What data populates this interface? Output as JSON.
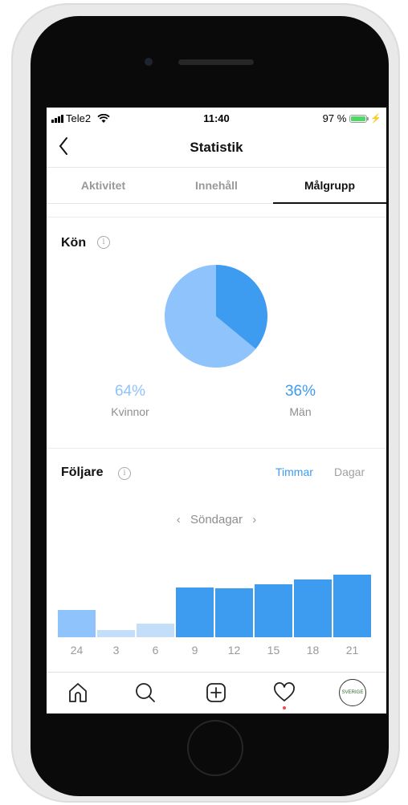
{
  "status_bar": {
    "carrier": "Tele2",
    "time": "11:40",
    "battery": "97 %",
    "battery_level": 0.97
  },
  "nav": {
    "title": "Statistik"
  },
  "tabs": [
    {
      "label": "Aktivitet",
      "active": false
    },
    {
      "label": "Innehåll",
      "active": false
    },
    {
      "label": "Målgrupp",
      "active": true
    }
  ],
  "gender": {
    "title": "Kön",
    "info_icon": "info-icon",
    "women": {
      "pct": "64%",
      "label": "Kvinnor",
      "value": 64,
      "color": "#8ec3fb"
    },
    "men": {
      "pct": "36%",
      "label": "Män",
      "value": 36,
      "color": "#3d9bf0"
    }
  },
  "followers": {
    "title": "Följare",
    "toggle_hours": "Timmar",
    "toggle_days": "Dagar",
    "day_label": "Söndagar",
    "prev_arrow": "‹",
    "next_arrow": "›"
  },
  "chart_data": {
    "type": "bar",
    "categories": [
      "24",
      "3",
      "6",
      "9",
      "12",
      "15",
      "18",
      "21"
    ],
    "values": [
      34,
      9,
      17,
      62,
      61,
      66,
      72,
      78
    ],
    "colors": [
      "#8ec3fb",
      "#c3def9",
      "#c3def9",
      "#3d9bf0",
      "#3d9bf0",
      "#3d9bf0",
      "#3d9bf0",
      "#3d9bf0"
    ],
    "ylim": [
      0,
      100
    ],
    "grid": false
  },
  "tab_bar": {
    "items": [
      "home-icon",
      "search-icon",
      "add-post-icon",
      "heart-icon",
      "profile-avatar"
    ],
    "profile_text": "SVERIGE"
  }
}
